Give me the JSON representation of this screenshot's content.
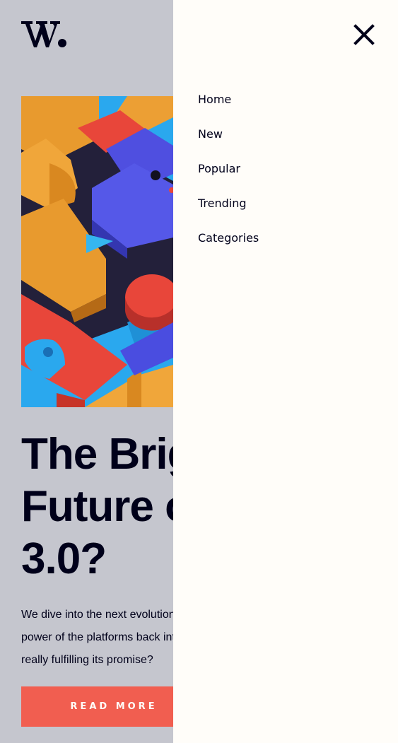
{
  "header": {
    "logo_text": "W."
  },
  "article": {
    "headline_lines": [
      "The Bright",
      "Future of Web",
      "3.0?"
    ],
    "excerpt_lines": [
      "We dive into the next evolution of the web that claims to put the",
      "power of the platforms back into the hands of the people. But is it",
      "really fulfilling its promise?"
    ],
    "cta_label": "READ MORE"
  },
  "drawer": {
    "close_icon": "close-icon",
    "nav": [
      {
        "label": "Home"
      },
      {
        "label": "New"
      },
      {
        "label": "Popular"
      },
      {
        "label": "Trending"
      },
      {
        "label": "Categories"
      }
    ]
  },
  "colors": {
    "page_bg": "#c5c6ce",
    "drawer_bg": "#fffdf9",
    "accent": "#f15e50",
    "text": "#00001a"
  }
}
